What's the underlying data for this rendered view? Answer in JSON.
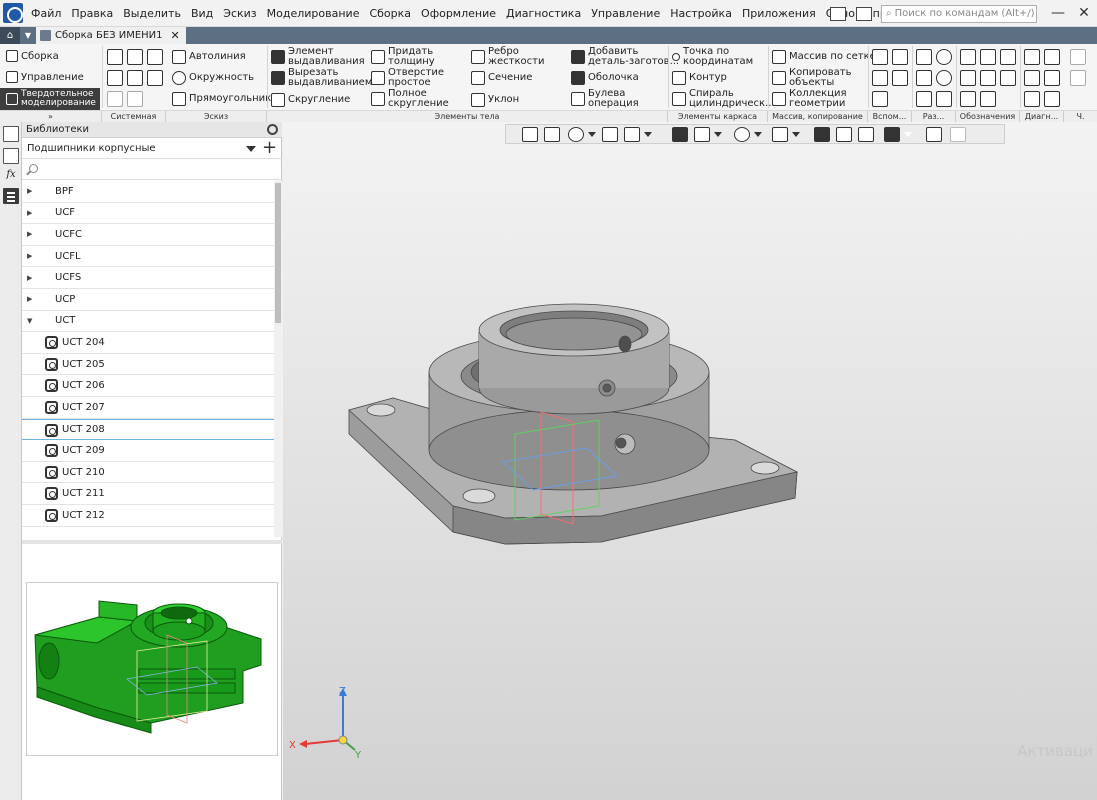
{
  "menu": [
    "Файл",
    "Правка",
    "Выделить",
    "Вид",
    "Эскиз",
    "Моделирование",
    "Сборка",
    "Оформление",
    "Диагностика",
    "Управление",
    "Настройка",
    "Приложения",
    "Окно",
    "Справка"
  ],
  "search_placeholder": "Поиск по командам (Alt+/)",
  "window_controls": {
    "minimize": "—",
    "close": "✕"
  },
  "doc_tab": {
    "title": "Сборка БЕЗ ИМЕНИ1",
    "close": "✕"
  },
  "side_top_tabs": [
    "Сборка",
    "Управление",
    "Твердотельное\nмоделирование"
  ],
  "ribbon": {
    "system": [
      "Автолиния",
      "Окружность",
      "Прямоугольник"
    ],
    "body": [
      "Элемент\nвыдавливания",
      "Вырезать\nвыдавливанием",
      "Скругление",
      "Придать\nтолщину",
      "Отверстие\nпростое",
      "Полное\nскругление",
      "Ребро\nжесткости",
      "Сечение",
      "Уклон",
      "Добавить\nдеталь-заготов...",
      "Оболочка",
      "Булева\nоперация"
    ],
    "frame": [
      "Точка по\nкоординатам",
      "Контур",
      "Спираль\nцилиндрическ..."
    ],
    "array": [
      "Массив по сетке",
      "Копировать\nобъекты",
      "Коллекция\nгеометрии"
    ]
  },
  "ribbon_groups": [
    "Системная",
    "Эскиз",
    "Элементы тела",
    "Элементы каркаса",
    "Массив, копирование",
    "Вспом...",
    "Раз...",
    "Обозначения",
    "Диагн...",
    "Ч."
  ],
  "libraries": {
    "header": "Библиотеки",
    "selected_library": "Подшипники корпусные",
    "add": "+",
    "items": [
      {
        "label": "BPF",
        "expanded": false,
        "child": false
      },
      {
        "label": "UCF",
        "expanded": false,
        "child": false
      },
      {
        "label": "UCFC",
        "expanded": false,
        "child": false
      },
      {
        "label": "UCFL",
        "expanded": false,
        "child": false
      },
      {
        "label": "UCFS",
        "expanded": false,
        "child": false
      },
      {
        "label": "UCP",
        "expanded": false,
        "child": false
      },
      {
        "label": "UCT",
        "expanded": true,
        "child": false
      },
      {
        "label": "UCT 204",
        "child": true
      },
      {
        "label": "UCT 205",
        "child": true
      },
      {
        "label": "UCT 206",
        "child": true
      },
      {
        "label": "UCT 207",
        "child": true
      },
      {
        "label": "UCT 208",
        "child": true,
        "selected": true
      },
      {
        "label": "UCT 209",
        "child": true
      },
      {
        "label": "UCT 210",
        "child": true
      },
      {
        "label": "UCT 211",
        "child": true
      },
      {
        "label": "UCT 212",
        "child": true
      }
    ]
  },
  "strip_buttons": {
    "formula": "fx"
  },
  "axes": {
    "x": "X",
    "y": "Y",
    "z": "Z"
  },
  "watermark": "Активаци",
  "colors": {
    "preview_part": "#1fa81f",
    "model": "#9a9a9a",
    "accent": "#6cb2dd"
  }
}
